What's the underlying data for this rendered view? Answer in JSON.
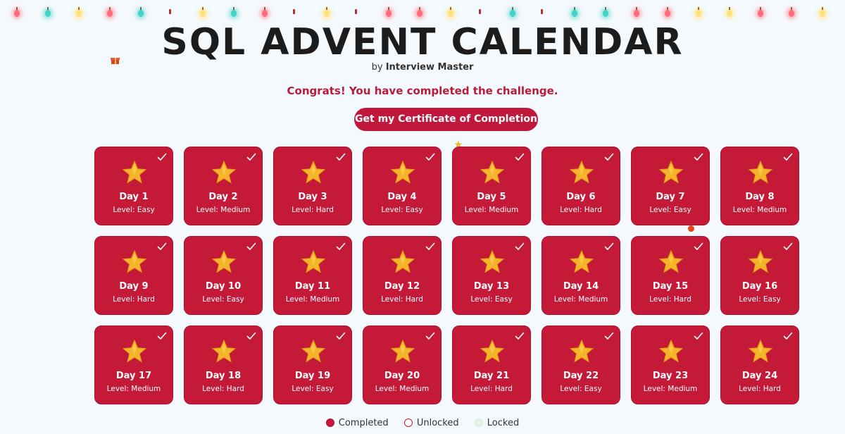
{
  "header": {
    "title": "SQL ADVENT CALENDAR",
    "byline_prefix": "by",
    "byline_name": "Interview Master"
  },
  "status": {
    "message": "Congrats! You have completed the challenge.",
    "certificate_button": "Get my Certificate of Completion"
  },
  "colors": {
    "accent": "#c41a38",
    "star": "#f5b52b",
    "background": "#f4f9fd"
  },
  "days": [
    {
      "label": "Day 1",
      "level": "Level: Easy",
      "state": "completed"
    },
    {
      "label": "Day 2",
      "level": "Level: Medium",
      "state": "completed"
    },
    {
      "label": "Day 3",
      "level": "Level: Hard",
      "state": "completed"
    },
    {
      "label": "Day 4",
      "level": "Level: Easy",
      "state": "completed"
    },
    {
      "label": "Day 5",
      "level": "Level: Medium",
      "state": "completed"
    },
    {
      "label": "Day 6",
      "level": "Level: Hard",
      "state": "completed"
    },
    {
      "label": "Day 7",
      "level": "Level: Easy",
      "state": "completed"
    },
    {
      "label": "Day 8",
      "level": "Level: Medium",
      "state": "completed"
    },
    {
      "label": "Day 9",
      "level": "Level: Hard",
      "state": "completed"
    },
    {
      "label": "Day 10",
      "level": "Level: Easy",
      "state": "completed"
    },
    {
      "label": "Day 11",
      "level": "Level: Medium",
      "state": "completed"
    },
    {
      "label": "Day 12",
      "level": "Level: Hard",
      "state": "completed"
    },
    {
      "label": "Day 13",
      "level": "Level: Easy",
      "state": "completed"
    },
    {
      "label": "Day 14",
      "level": "Level: Medium",
      "state": "completed"
    },
    {
      "label": "Day 15",
      "level": "Level: Hard",
      "state": "completed"
    },
    {
      "label": "Day 16",
      "level": "Level: Easy",
      "state": "completed"
    },
    {
      "label": "Day 17",
      "level": "Level: Medium",
      "state": "completed"
    },
    {
      "label": "Day 18",
      "level": "Level: Hard",
      "state": "completed"
    },
    {
      "label": "Day 19",
      "level": "Level: Easy",
      "state": "completed"
    },
    {
      "label": "Day 20",
      "level": "Level: Medium",
      "state": "completed"
    },
    {
      "label": "Day 21",
      "level": "Level: Hard",
      "state": "completed"
    },
    {
      "label": "Day 22",
      "level": "Level: Easy",
      "state": "completed"
    },
    {
      "label": "Day 23",
      "level": "Level: Medium",
      "state": "completed"
    },
    {
      "label": "Day 24",
      "level": "Level: Hard",
      "state": "completed"
    }
  ],
  "legend": [
    {
      "label": "Completed",
      "key": "completed"
    },
    {
      "label": "Unlocked",
      "key": "unlocked"
    },
    {
      "label": "Locked",
      "key": "locked"
    }
  ]
}
